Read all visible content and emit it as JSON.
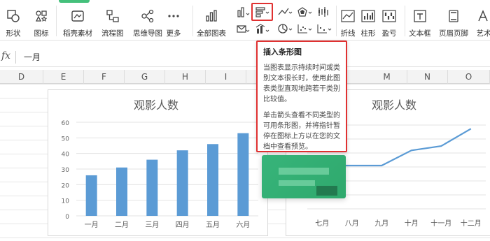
{
  "ribbon": {
    "shape_label": "形状",
    "icon_label": "图标",
    "daoke_label": "稻壳素材",
    "flowchart_label": "流程图",
    "mindmap_label": "思维导图",
    "more_label": "更多",
    "allcharts_label": "全部图表",
    "line_label": "折线",
    "column_label": "柱形",
    "winloss_label": "盈亏",
    "textbox_label": "文本框",
    "headerfooter_label": "页眉页脚",
    "art_label": "艺术"
  },
  "formula": {
    "fx": "fx",
    "value": "一月"
  },
  "columns": [
    "D",
    "E",
    "F",
    "G",
    "H",
    "I",
    "M",
    "N",
    "O"
  ],
  "tooltip": {
    "title": "插入条形图",
    "p1": "当图表显示持续时间或类别文本很长时，使用此图表类型直观地跨若干类别比较值。",
    "p2": "单击箭头查看不同类型的可用条形图，并将指针暂停在图标上方以在您的文档中查看预览。"
  },
  "chart_data": [
    {
      "type": "bar",
      "title": "观影人数",
      "categories": [
        "一月",
        "二月",
        "三月",
        "四月",
        "五月",
        "六月"
      ],
      "values": [
        26,
        31,
        36,
        42,
        46,
        53
      ],
      "ylim": [
        0,
        60
      ],
      "yticks": [
        0,
        10,
        20,
        30,
        40,
        50,
        60
      ],
      "color": "#5b9bd5",
      "grid": true
    },
    {
      "type": "line",
      "title": "观影人数",
      "categories": [
        "七月",
        "八月",
        "九月",
        "十月",
        "十一月",
        "十二月"
      ],
      "values": [
        20,
        20,
        20,
        27,
        29,
        37
      ],
      "color": "#5b9bd5",
      "grid": true
    }
  ]
}
